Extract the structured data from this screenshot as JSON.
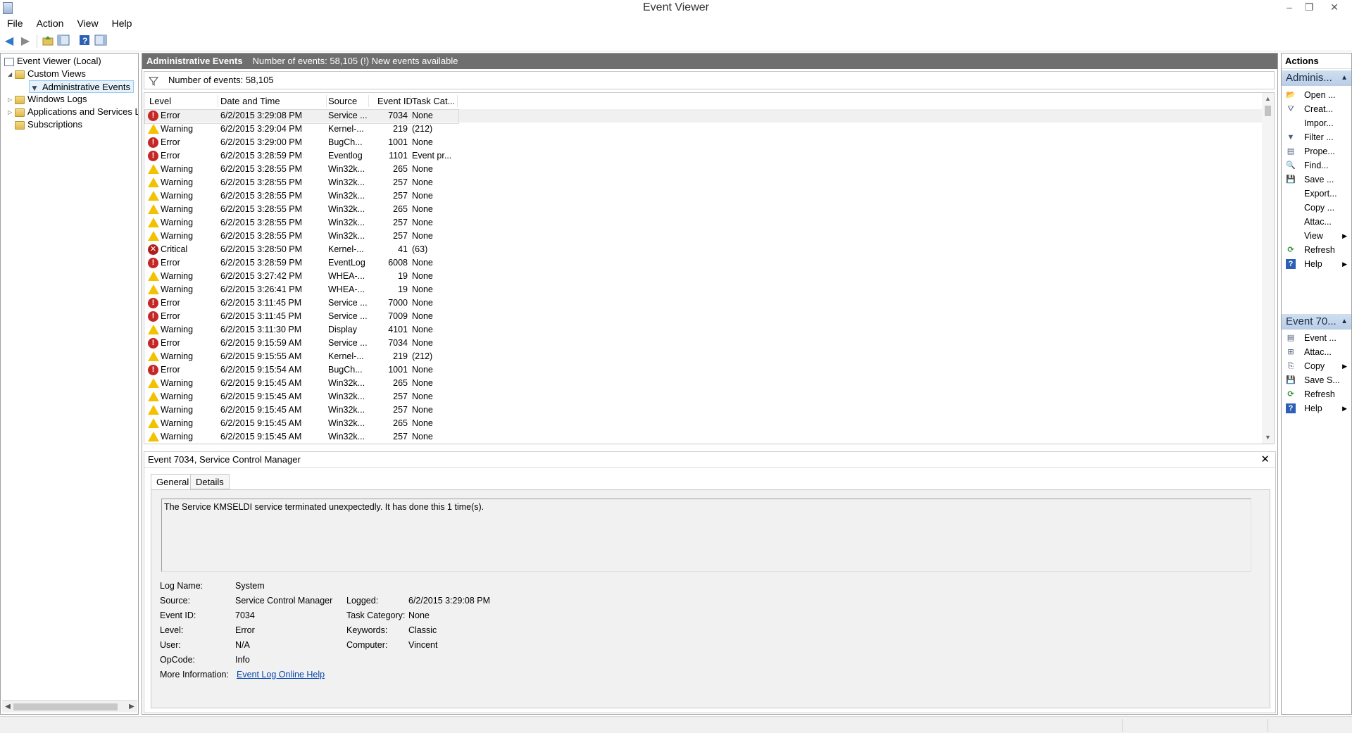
{
  "window": {
    "title": "Event Viewer",
    "controls": [
      "–",
      "❐",
      "✕"
    ]
  },
  "menu": [
    "File",
    "Action",
    "View",
    "Help"
  ],
  "toolbar": {
    "icons": [
      "back-icon",
      "forward-icon",
      "up-folder-icon",
      "show-hide-console-tree-icon",
      "help-icon",
      "show-hide-action-pane-icon"
    ]
  },
  "tree": {
    "items": [
      {
        "label": "Event Viewer (Local)",
        "icon": "event-viewer-icon",
        "twisty": ""
      },
      {
        "label": "Custom Views",
        "icon": "folder-icon",
        "twisty": "◢"
      },
      {
        "label": "Administrative Events",
        "icon": "filter-icon",
        "twisty": ""
      },
      {
        "label": "Windows Logs",
        "icon": "folder-icon",
        "twisty": "▷"
      },
      {
        "label": "Applications and Services Lo",
        "icon": "folder-icon",
        "twisty": "▷"
      },
      {
        "label": "Subscriptions",
        "icon": "subscriptions-icon",
        "twisty": ""
      }
    ]
  },
  "center": {
    "band_title": "Administrative Events",
    "band_info": "Number of events: 58,105 (!) New events available",
    "filter_text": "Number of events: 58,105",
    "columns": [
      "Level",
      "Date and Time",
      "Source",
      "Event ID",
      "Task Cat..."
    ],
    "rows": [
      {
        "level": "Error",
        "date": "6/2/2015 3:29:08 PM",
        "source": "Service ...",
        "id": "7034",
        "task": "None"
      },
      {
        "level": "Warning",
        "date": "6/2/2015 3:29:04 PM",
        "source": "Kernel-...",
        "id": "219",
        "task": "(212)"
      },
      {
        "level": "Error",
        "date": "6/2/2015 3:29:00 PM",
        "source": "BugCh...",
        "id": "1001",
        "task": "None"
      },
      {
        "level": "Error",
        "date": "6/2/2015 3:28:59 PM",
        "source": "Eventlog",
        "id": "1101",
        "task": "Event pr..."
      },
      {
        "level": "Warning",
        "date": "6/2/2015 3:28:55 PM",
        "source": "Win32k...",
        "id": "265",
        "task": "None"
      },
      {
        "level": "Warning",
        "date": "6/2/2015 3:28:55 PM",
        "source": "Win32k...",
        "id": "257",
        "task": "None"
      },
      {
        "level": "Warning",
        "date": "6/2/2015 3:28:55 PM",
        "source": "Win32k...",
        "id": "257",
        "task": "None"
      },
      {
        "level": "Warning",
        "date": "6/2/2015 3:28:55 PM",
        "source": "Win32k...",
        "id": "265",
        "task": "None"
      },
      {
        "level": "Warning",
        "date": "6/2/2015 3:28:55 PM",
        "source": "Win32k...",
        "id": "257",
        "task": "None"
      },
      {
        "level": "Warning",
        "date": "6/2/2015 3:28:55 PM",
        "source": "Win32k...",
        "id": "257",
        "task": "None"
      },
      {
        "level": "Critical",
        "date": "6/2/2015 3:28:50 PM",
        "source": "Kernel-...",
        "id": "41",
        "task": "(63)"
      },
      {
        "level": "Error",
        "date": "6/2/2015 3:28:59 PM",
        "source": "EventLog",
        "id": "6008",
        "task": "None"
      },
      {
        "level": "Warning",
        "date": "6/2/2015 3:27:42 PM",
        "source": "WHEA-...",
        "id": "19",
        "task": "None"
      },
      {
        "level": "Warning",
        "date": "6/2/2015 3:26:41 PM",
        "source": "WHEA-...",
        "id": "19",
        "task": "None"
      },
      {
        "level": "Error",
        "date": "6/2/2015 3:11:45 PM",
        "source": "Service ...",
        "id": "7000",
        "task": "None"
      },
      {
        "level": "Error",
        "date": "6/2/2015 3:11:45 PM",
        "source": "Service ...",
        "id": "7009",
        "task": "None"
      },
      {
        "level": "Warning",
        "date": "6/2/2015 3:11:30 PM",
        "source": "Display",
        "id": "4101",
        "task": "None"
      },
      {
        "level": "Error",
        "date": "6/2/2015 9:15:59 AM",
        "source": "Service ...",
        "id": "7034",
        "task": "None"
      },
      {
        "level": "Warning",
        "date": "6/2/2015 9:15:55 AM",
        "source": "Kernel-...",
        "id": "219",
        "task": "(212)"
      },
      {
        "level": "Error",
        "date": "6/2/2015 9:15:54 AM",
        "source": "BugCh...",
        "id": "1001",
        "task": "None"
      },
      {
        "level": "Warning",
        "date": "6/2/2015 9:15:45 AM",
        "source": "Win32k...",
        "id": "265",
        "task": "None"
      },
      {
        "level": "Warning",
        "date": "6/2/2015 9:15:45 AM",
        "source": "Win32k...",
        "id": "257",
        "task": "None"
      },
      {
        "level": "Warning",
        "date": "6/2/2015 9:15:45 AM",
        "source": "Win32k...",
        "id": "257",
        "task": "None"
      },
      {
        "level": "Warning",
        "date": "6/2/2015 9:15:45 AM",
        "source": "Win32k...",
        "id": "265",
        "task": "None"
      },
      {
        "level": "Warning",
        "date": "6/2/2015 9:15:45 AM",
        "source": "Win32k...",
        "id": "257",
        "task": "None"
      }
    ]
  },
  "detail": {
    "header": "Event 7034, Service Control Manager",
    "close": "✕",
    "tabs": [
      "General",
      "Details"
    ],
    "description": "The Service KMSELDI service terminated unexpectedly.  It has done this 1 time(s).",
    "fields": {
      "log_name_label": "Log Name:",
      "log_name": "System",
      "source_label": "Source:",
      "source": "Service Control Manager",
      "logged_label": "Logged:",
      "logged": "6/2/2015 3:29:08 PM",
      "event_id_label": "Event ID:",
      "event_id": "7034",
      "task_label": "Task Category:",
      "task": "None",
      "level_label": "Level:",
      "level": "Error",
      "keywords_label": "Keywords:",
      "keywords": "Classic",
      "user_label": "User:",
      "user": "N/A",
      "computer_label": "Computer:",
      "computer": "Vincent",
      "opcode_label": "OpCode:",
      "opcode": "Info",
      "more_label": "More Information:",
      "more_link": "Event Log Online Help"
    }
  },
  "actions": {
    "header": "Actions",
    "section1": "Adminis...",
    "section1_items": [
      {
        "label": "Open ...",
        "icon": "open-icon"
      },
      {
        "label": "Creat...",
        "icon": "create-filter-icon"
      },
      {
        "label": "Impor...",
        "icon": ""
      },
      {
        "label": "Filter ...",
        "icon": "filter-icon"
      },
      {
        "label": "Prope...",
        "icon": "properties-icon"
      },
      {
        "label": "Find...",
        "icon": "find-icon"
      },
      {
        "label": "Save ...",
        "icon": "save-icon"
      },
      {
        "label": "Export...",
        "icon": ""
      },
      {
        "label": "Copy ...",
        "icon": ""
      },
      {
        "label": "Attac...",
        "icon": ""
      },
      {
        "label": "View",
        "icon": "",
        "sub": true
      },
      {
        "label": "Refresh",
        "icon": "refresh-icon"
      },
      {
        "label": "Help",
        "icon": "help-icon",
        "sub": true
      }
    ],
    "section2": "Event 70...",
    "section2_items": [
      {
        "label": "Event ...",
        "icon": "event-properties-icon"
      },
      {
        "label": "Attac...",
        "icon": "attach-task-icon"
      },
      {
        "label": "Copy",
        "icon": "copy-icon",
        "sub": true
      },
      {
        "label": "Save S...",
        "icon": "save-icon"
      },
      {
        "label": "Refresh",
        "icon": "refresh-icon"
      },
      {
        "label": "Help",
        "icon": "help-icon",
        "sub": true
      }
    ]
  },
  "colors": {
    "error": "#c52626",
    "warning": "#f2c200",
    "band": "#6f6f6f",
    "action_section": "#c5d7ed",
    "link": "#0645ad"
  }
}
